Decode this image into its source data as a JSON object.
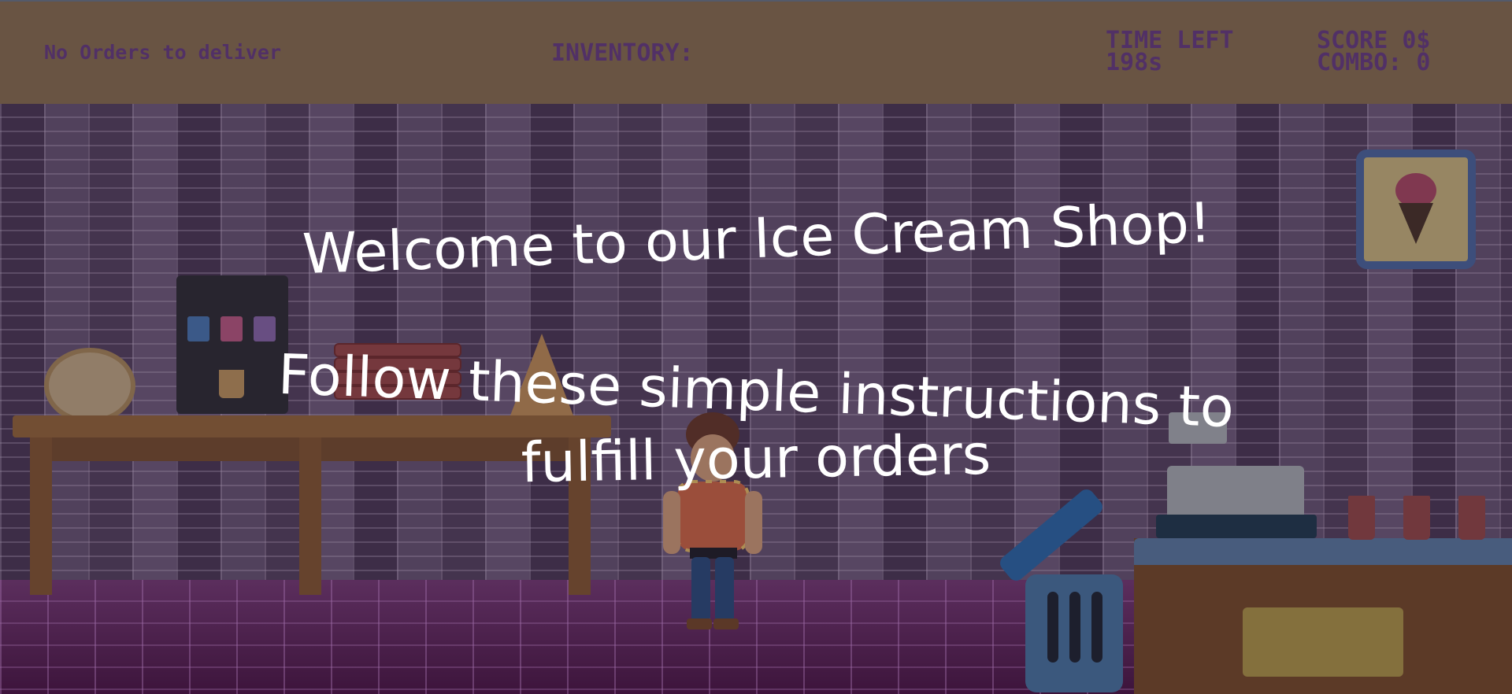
{
  "hud": {
    "orders_text": "No Orders to deliver",
    "inventory_label": "INVENTORY:",
    "time_label": "TIME LEFT",
    "time_value": "198s",
    "score_text": "SCORE 0$",
    "combo_text": "COMBO: 0"
  },
  "dialog": {
    "welcome": "Welcome to our Ice Cream Shop!",
    "instructions_line1": "Follow these simple instructions to",
    "instructions_line2": "fulfill your orders"
  },
  "scene": {
    "icons": [
      "ice-cream-sign-icon",
      "trash-bin-icon",
      "cash-register-icon"
    ],
    "colors": {
      "hud_bar": "#8e7453",
      "hud_text": "#6a3f86",
      "wall": "#5f4b6b",
      "floor": "#5c1f5c"
    }
  }
}
